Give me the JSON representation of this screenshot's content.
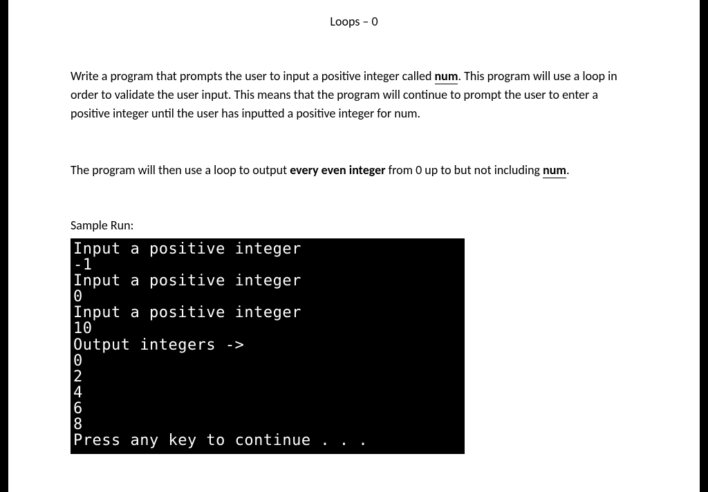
{
  "title": "Loops – 0",
  "para1_pre": "Write a program that prompts the user to input a positive integer called ",
  "para1_num": "num",
  "para1_post": ".  This program will use a loop in order to validate the user input.  This means that the program will continue to prompt the user to enter a positive integer until the user has inputted a positive integer for num.",
  "para2_pre": "The program will then use a loop to output ",
  "para2_bold": "every even integer",
  "para2_mid": " from 0 up to but not including ",
  "para2_num": "num",
  "para2_post": ".",
  "sample_label": "Sample Run:",
  "terminal_lines": [
    "Input a positive integer",
    "-1",
    "Input a positive integer",
    "0",
    "Input a positive integer",
    "10",
    "Output integers ->",
    "0",
    "2",
    "4",
    "6",
    "8",
    "Press any key to continue . . ."
  ]
}
